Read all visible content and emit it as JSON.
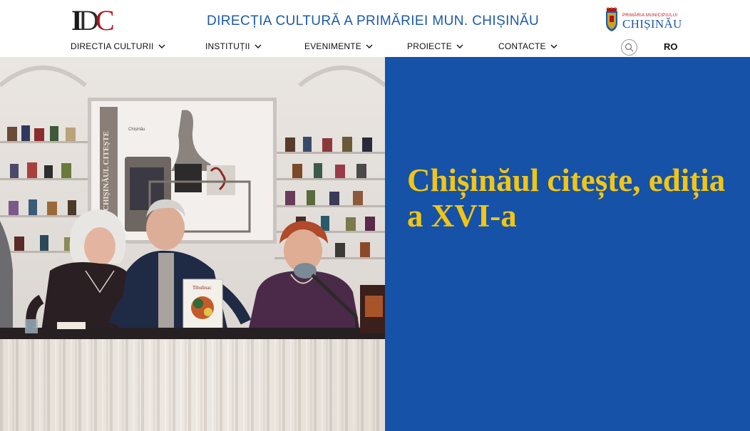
{
  "header": {
    "logo_letters": {
      "i": "I",
      "d": "D",
      "c": "C"
    },
    "site_title": "DIRECȚIA CULTURĂ A PRIMĂRIEI MUN. CHIȘINĂU",
    "city_logo": {
      "top_line": "PRIMĂRIA MUNICIPIULUI",
      "main": "CHIȘINĂU"
    },
    "lang": "RO",
    "search_icon": "search-icon"
  },
  "nav": {
    "items": [
      {
        "label": "DIRECTIA CULTURII",
        "icon": "chevron-down-icon"
      },
      {
        "label": "INSTITUȚII",
        "icon": "chevron-down-icon"
      },
      {
        "label": "EVENIMENTE",
        "icon": "chevron-down-icon"
      },
      {
        "label": "PROIECTE",
        "icon": "chevron-down-icon"
      },
      {
        "label": "CONTACTE",
        "icon": "chevron-down-icon"
      }
    ]
  },
  "hero": {
    "title": "Chișinăul citește, ediția a XVI-a",
    "photo": {
      "screen_vertical_text": "CHIȘINĂUL CITEȘTE",
      "screen_logo_text": "Chișinău",
      "book_title": "Tibulinac"
    }
  },
  "colors": {
    "brand_blue": "#1552a8",
    "title_yellow": "#f2c515",
    "title_link_blue": "#1c5aa8",
    "logo_red": "#b3121c"
  }
}
